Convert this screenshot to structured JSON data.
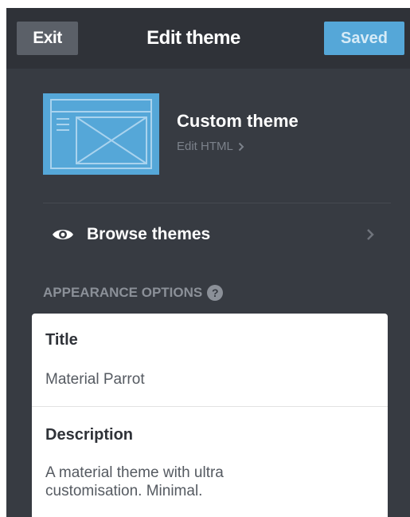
{
  "header": {
    "exit_label": "Exit",
    "title": "Edit theme",
    "saved_label": "Saved"
  },
  "theme": {
    "name": "Custom theme",
    "edit_html_label": "Edit HTML",
    "thumbnail_icon": "layout-icon"
  },
  "browse": {
    "label": "Browse themes",
    "icon": "eye-icon"
  },
  "appearance": {
    "section_label": "APPEARANCE OPTIONS",
    "help_glyph": "?",
    "fields": [
      {
        "label": "Title",
        "value": "Material Parrot"
      },
      {
        "label": "Description",
        "value": "A material theme with ultra customisation. Minimal."
      }
    ]
  },
  "colors": {
    "panel": "#373b42",
    "topbar": "#2f3238",
    "accent": "#55a7d8",
    "exit_button": "#5b6068"
  }
}
